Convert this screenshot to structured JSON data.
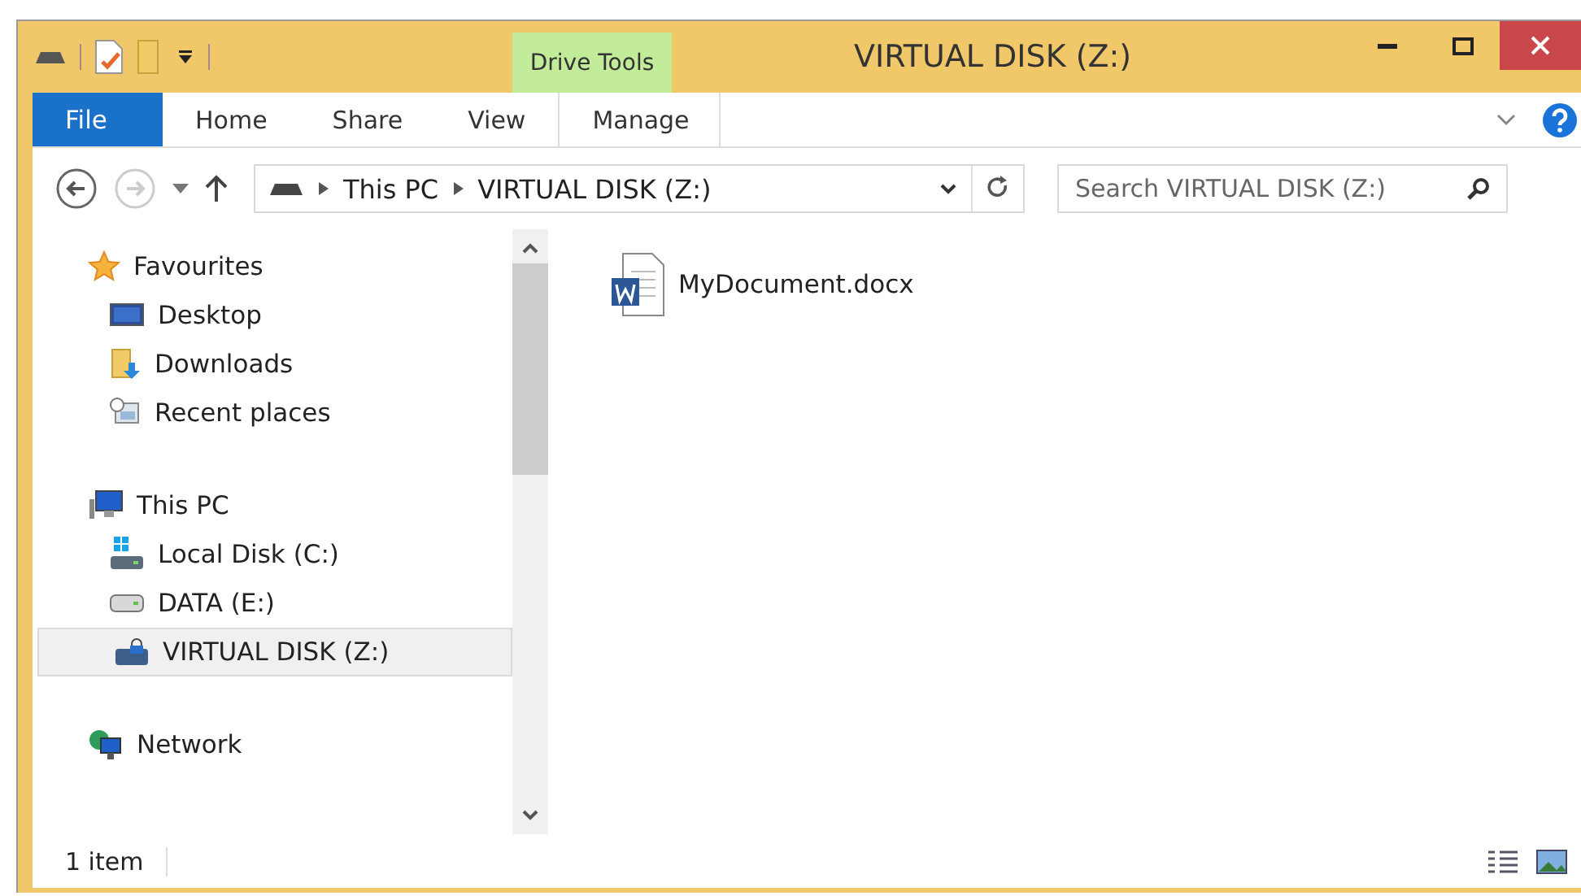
{
  "window": {
    "title": "VIRTUAL DISK (Z:)",
    "context_tab": "Drive Tools"
  },
  "ribbon_tabs": [
    {
      "label": "File",
      "kind": "file",
      "selected": false
    },
    {
      "label": "Home",
      "kind": "tab",
      "selected": false
    },
    {
      "label": "Share",
      "kind": "tab",
      "selected": false
    },
    {
      "label": "View",
      "kind": "tab",
      "selected": false
    },
    {
      "label": "Manage",
      "kind": "context",
      "selected": false
    }
  ],
  "address": {
    "path": [
      "This PC",
      "VIRTUAL DISK (Z:)"
    ]
  },
  "search": {
    "placeholder": "Search VIRTUAL DISK (Z:)"
  },
  "nav": [
    {
      "label": "Favourites",
      "kind": "star",
      "selected": false,
      "children": [
        {
          "label": "Desktop",
          "kind": "desktop",
          "selected": false
        },
        {
          "label": "Downloads",
          "kind": "downloads",
          "selected": false
        },
        {
          "label": "Recent places",
          "kind": "recent",
          "selected": false
        }
      ]
    },
    {
      "label": "This PC",
      "kind": "pc",
      "selected": false,
      "children": [
        {
          "label": "Local Disk (C:)",
          "kind": "sysdisk",
          "selected": false
        },
        {
          "label": "DATA (E:)",
          "kind": "disk",
          "selected": false
        },
        {
          "label": "VIRTUAL DISK (Z:)",
          "kind": "vdisk",
          "selected": true
        }
      ]
    },
    {
      "label": "Network",
      "kind": "network",
      "selected": false
    }
  ],
  "files": [
    {
      "name": "MyDocument.docx"
    }
  ],
  "status_bar": {
    "count": "1 item"
  }
}
